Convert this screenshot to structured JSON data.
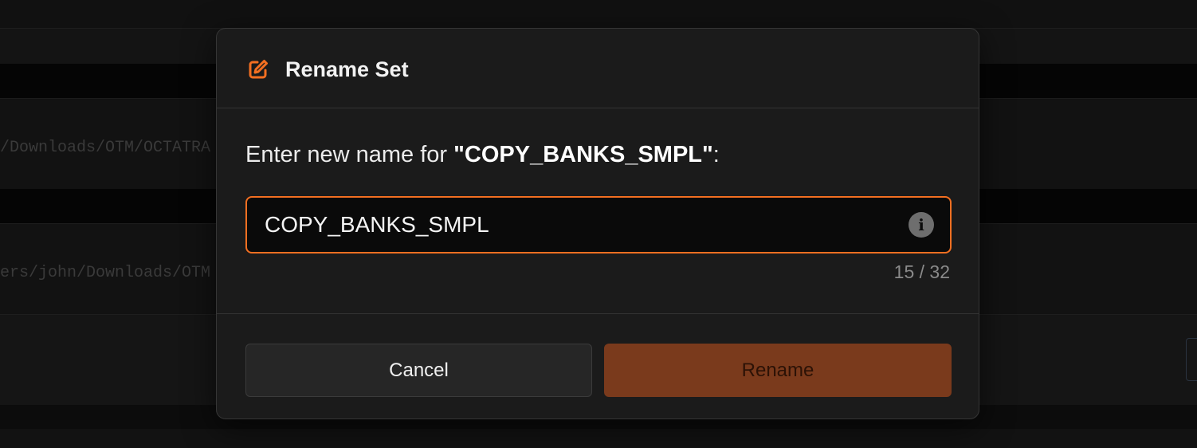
{
  "background": {
    "path_1": "/Downloads/OTM/OCTATRA",
    "path_2": "ers/john/Downloads/OTM"
  },
  "modal": {
    "title": "Rename Set",
    "title_icon": "edit-icon",
    "prompt_prefix": "Enter new name for ",
    "prompt_target": "\"COPY_BANKS_SMPL\"",
    "prompt_suffix": ":",
    "input_value": "COPY_BANKS_SMPL",
    "info_icon": "info-icon",
    "counter": "15 / 32",
    "cancel_label": "Cancel",
    "rename_label": "Rename"
  },
  "colors": {
    "accent": "#f36f21",
    "rename_button": "#7a3a1c",
    "modal_bg": "#1b1b1b"
  }
}
